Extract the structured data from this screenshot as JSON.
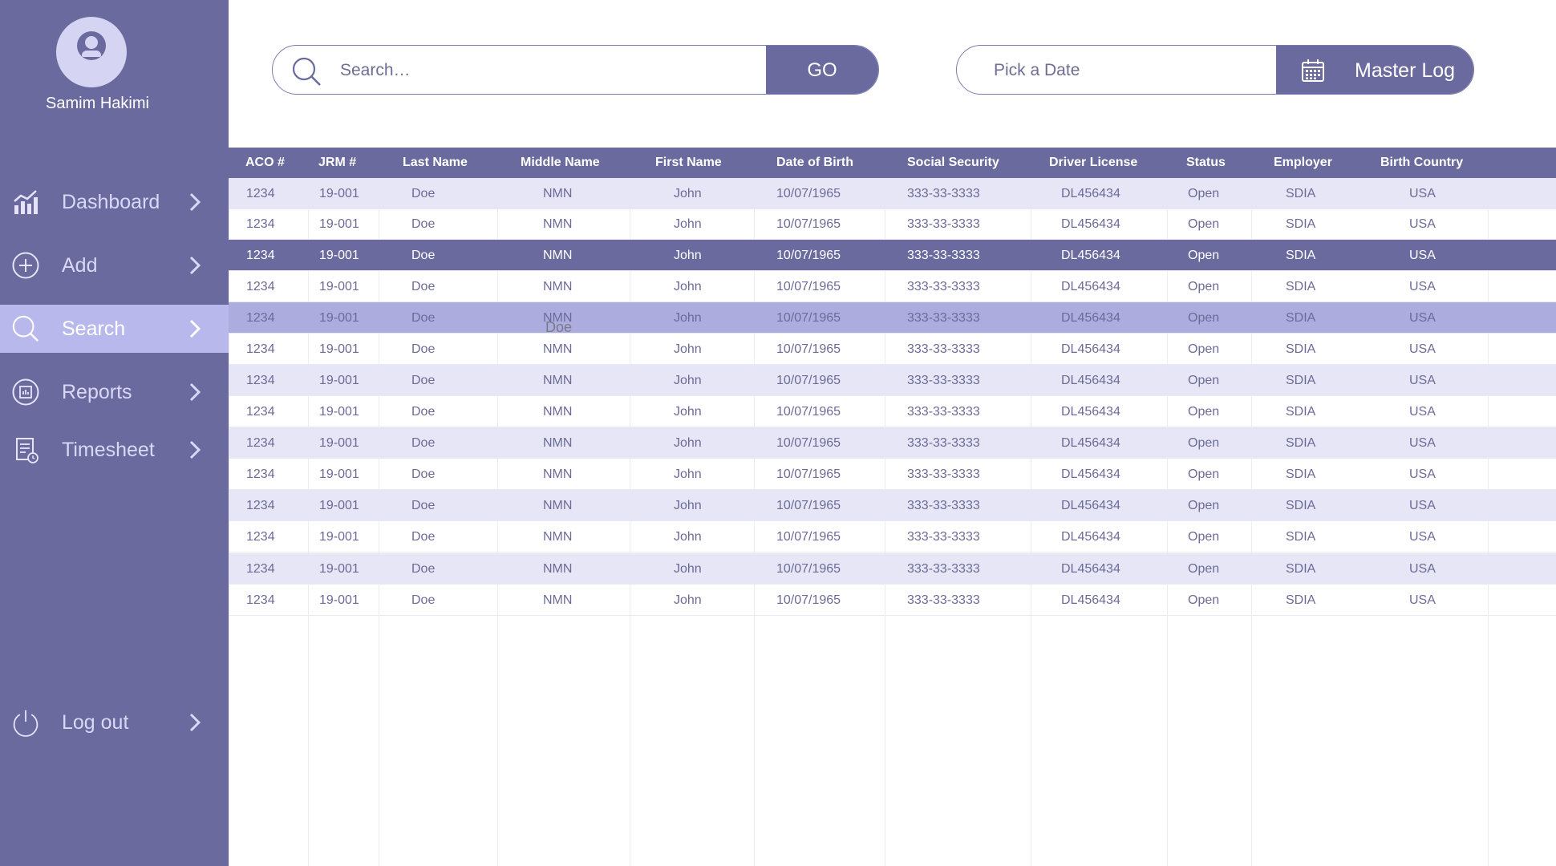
{
  "user": {
    "name": "Samim Hakimi"
  },
  "nav": [
    {
      "label": "Dashboard",
      "icon": "bar-chart-icon",
      "active": false
    },
    {
      "label": "Add",
      "icon": "plus-circle-icon",
      "active": false
    },
    {
      "label": "Search",
      "icon": "search-icon",
      "active": true
    },
    {
      "label": "Reports",
      "icon": "report-icon",
      "active": false
    },
    {
      "label": "Timesheet",
      "icon": "timesheet-icon",
      "active": false
    }
  ],
  "logout": {
    "label": "Log out",
    "icon": "power-icon"
  },
  "search": {
    "placeholder": "Search…",
    "go_label": "GO"
  },
  "date": {
    "placeholder": "Pick a Date",
    "master_label": "Master Log"
  },
  "table": {
    "columns": [
      "ACO #",
      "JRM #",
      "Last Name",
      "Middle Name",
      "First Name",
      "Date of Birth",
      "Social Security",
      "Driver License",
      "Status",
      "Employer",
      "Birth Country"
    ],
    "rows": [
      [
        "1234",
        "19-001",
        "Doe",
        "NMN",
        "John",
        "10/07/1965",
        "333-33-3333",
        "DL456434",
        "Open",
        "SDIA",
        "USA"
      ],
      [
        "1234",
        "19-001",
        "Doe",
        "NMN",
        "John",
        "10/07/1965",
        "333-33-3333",
        "DL456434",
        "Open",
        "SDIA",
        "USA"
      ],
      [
        "1234",
        "19-001",
        "Doe",
        "NMN",
        "John",
        "10/07/1965",
        "333-33-3333",
        "DL456434",
        "Open",
        "SDIA",
        "USA"
      ],
      [
        "1234",
        "19-001",
        "Doe",
        "NMN",
        "John",
        "10/07/1965",
        "333-33-3333",
        "DL456434",
        "Open",
        "SDIA",
        "USA"
      ],
      [
        "1234",
        "19-001",
        "Doe",
        "NMN",
        "John",
        "10/07/1965",
        "333-33-3333",
        "DL456434",
        "Open",
        "SDIA",
        "USA"
      ],
      [
        "1234",
        "19-001",
        "Doe",
        "NMN",
        "John",
        "10/07/1965",
        "333-33-3333",
        "DL456434",
        "Open",
        "SDIA",
        "USA"
      ],
      [
        "1234",
        "19-001",
        "Doe",
        "NMN",
        "John",
        "10/07/1965",
        "333-33-3333",
        "DL456434",
        "Open",
        "SDIA",
        "USA"
      ],
      [
        "1234",
        "19-001",
        "Doe",
        "NMN",
        "John",
        "10/07/1965",
        "333-33-3333",
        "DL456434",
        "Open",
        "SDIA",
        "USA"
      ],
      [
        "1234",
        "19-001",
        "Doe",
        "NMN",
        "John",
        "10/07/1965",
        "333-33-3333",
        "DL456434",
        "Open",
        "SDIA",
        "USA"
      ],
      [
        "1234",
        "19-001",
        "Doe",
        "NMN",
        "John",
        "10/07/1965",
        "333-33-3333",
        "DL456434",
        "Open",
        "SDIA",
        "USA"
      ],
      [
        "1234",
        "19-001",
        "Doe",
        "NMN",
        "John",
        "10/07/1965",
        "333-33-3333",
        "DL456434",
        "Open",
        "SDIA",
        "USA"
      ],
      [
        "1234",
        "19-001",
        "Doe",
        "NMN",
        "John",
        "10/07/1965",
        "333-33-3333",
        "DL456434",
        "Open",
        "SDIA",
        "USA"
      ],
      [
        "1234",
        "19-001",
        "Doe",
        "NMN",
        "John",
        "10/07/1965",
        "333-33-3333",
        "DL456434",
        "Open",
        "SDIA",
        "USA"
      ],
      [
        "1234",
        "19-001",
        "Doe",
        "NMN",
        "John",
        "10/07/1965",
        "333-33-3333",
        "DL456434",
        "Open",
        "SDIA",
        "USA"
      ]
    ],
    "selected_row": 2,
    "hovered_row": 4,
    "drag_text": "Doe"
  },
  "colors": {
    "primary": "#6a6a9e",
    "active_nav": "#b9b8ec",
    "stripe": "#e6e6f6",
    "hover": "#adacdf",
    "cell_text": "#6c6b98"
  }
}
